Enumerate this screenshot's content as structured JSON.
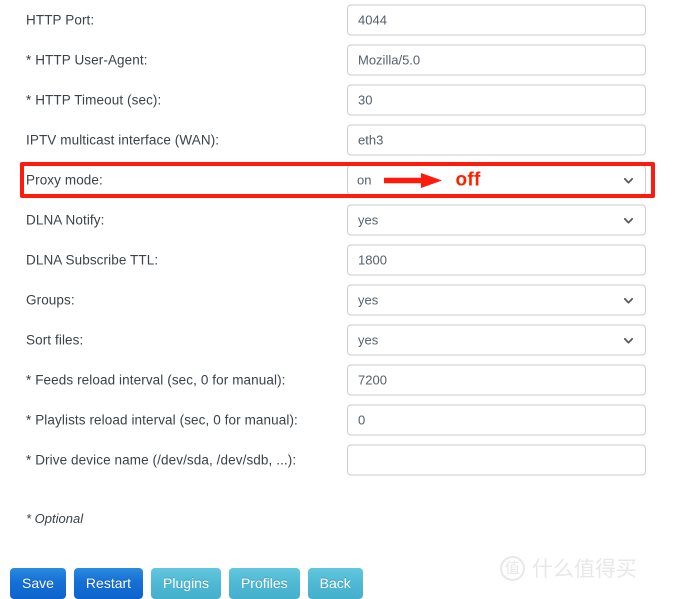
{
  "form": {
    "rows": [
      {
        "label": "HTTP Port:",
        "type": "text",
        "value": "4044"
      },
      {
        "label": "* HTTP User-Agent:",
        "type": "text",
        "value": "Mozilla/5.0"
      },
      {
        "label": "* HTTP Timeout (sec):",
        "type": "text",
        "value": "30"
      },
      {
        "label": "IPTV multicast interface (WAN):",
        "type": "text",
        "value": "eth3"
      },
      {
        "label": "Proxy mode:",
        "type": "select",
        "value": "on"
      },
      {
        "label": "DLNA Notify:",
        "type": "select",
        "value": "yes"
      },
      {
        "label": "DLNA Subscribe TTL:",
        "type": "text",
        "value": "1800"
      },
      {
        "label": "Groups:",
        "type": "select",
        "value": "yes"
      },
      {
        "label": "Sort files:",
        "type": "select",
        "value": "yes"
      },
      {
        "label": "* Feeds reload interval (sec, 0 for manual):",
        "type": "text",
        "value": "7200"
      },
      {
        "label": "* Playlists reload interval (sec, 0 for manual):",
        "type": "text",
        "value": "0"
      },
      {
        "label": "* Drive device name (/dev/sda, /dev/sdb, ...):",
        "type": "text",
        "value": ""
      }
    ]
  },
  "annotation": {
    "highlight_row_index": 4,
    "current_value": "on",
    "target_value": "off",
    "box_color": "#ff1a0d",
    "arrow_color": "#ff1a0d",
    "target_text_color": "#ff2000"
  },
  "note": {
    "optional_text": "* Optional"
  },
  "buttons": [
    {
      "label": "Save",
      "style": "primary"
    },
    {
      "label": "Restart",
      "style": "primary"
    },
    {
      "label": "Plugins",
      "style": "info"
    },
    {
      "label": "Profiles",
      "style": "info"
    },
    {
      "label": "Back",
      "style": "info"
    }
  ],
  "watermark": {
    "badge": "值",
    "text": "什么值得买"
  }
}
